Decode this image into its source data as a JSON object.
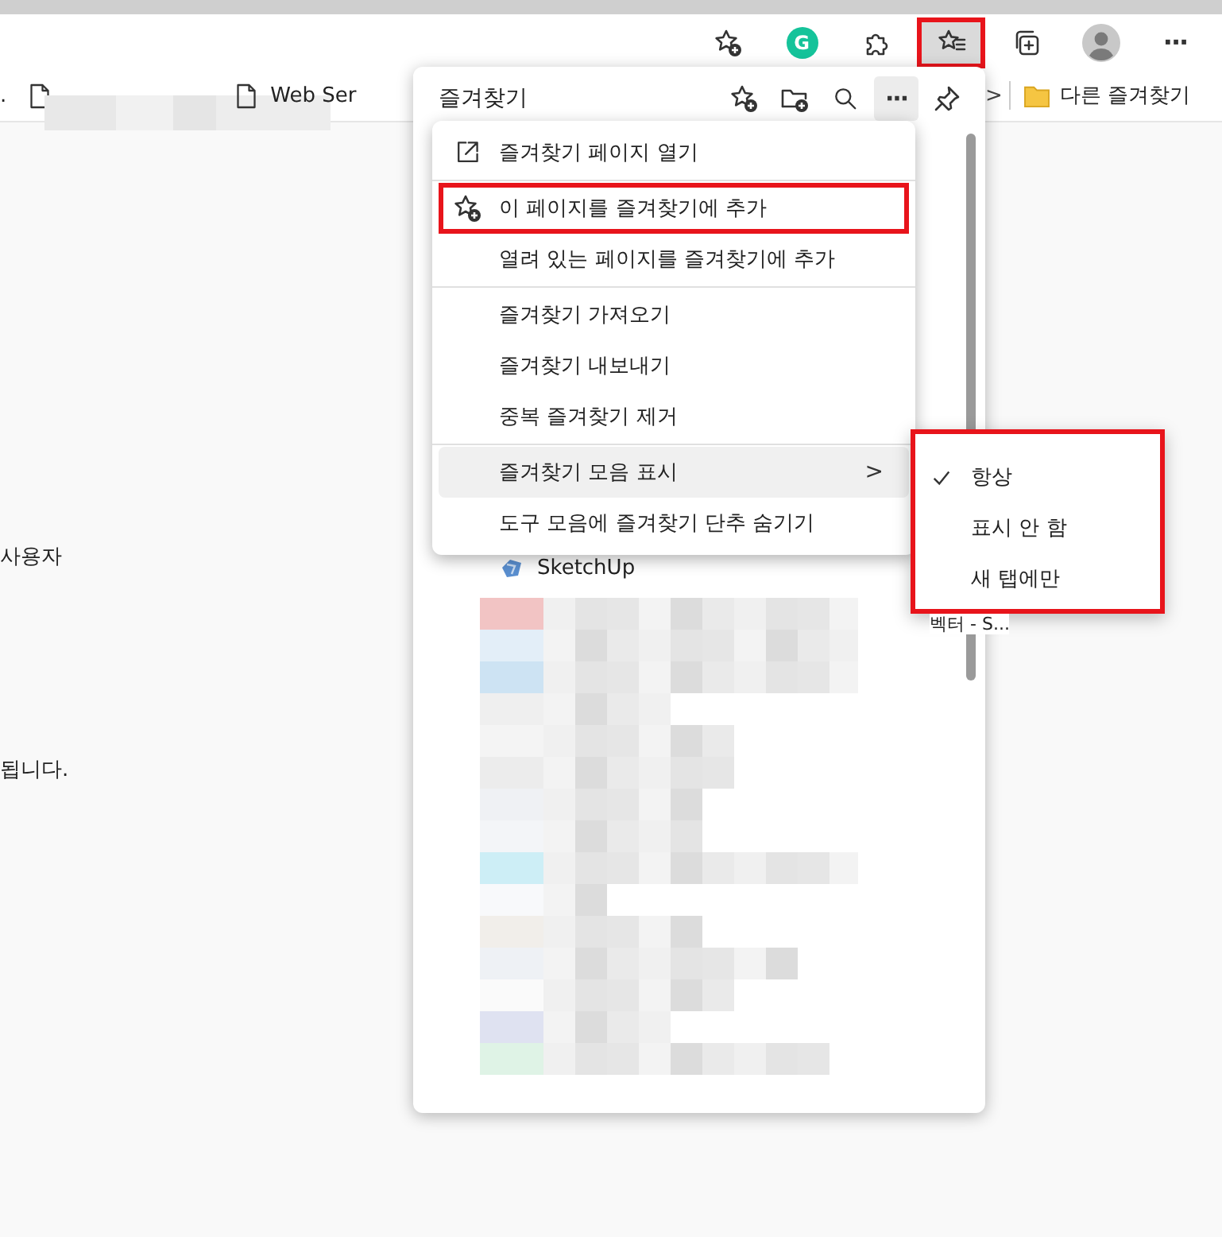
{
  "toolbar": {
    "buttons": [
      {
        "kind": "add_favorite",
        "highlighted": false
      },
      {
        "kind": "grammarly",
        "label": "G",
        "highlighted": false
      },
      {
        "kind": "extensions",
        "highlighted": false
      },
      {
        "kind": "favorites",
        "highlighted": true,
        "active": true
      },
      {
        "kind": "collections",
        "highlighted": false
      },
      {
        "kind": "profile",
        "highlighted": false
      },
      {
        "kind": "more",
        "label": "···",
        "highlighted": false
      }
    ]
  },
  "bookmarks_bar": {
    "items": [
      {
        "kind": "text",
        "label": "."
      },
      {
        "kind": "doc_redacted"
      },
      {
        "kind": "doc",
        "label": "Web Ser"
      }
    ],
    "overflow": ">",
    "other": "다른 즐겨찾기"
  },
  "page": {
    "texts": [
      "사용자",
      "됩니다."
    ]
  },
  "favorites_panel": {
    "title": "즐겨찾기",
    "header_buttons": [
      {
        "kind": "add_favorite"
      },
      {
        "kind": "add_folder"
      },
      {
        "kind": "search"
      },
      {
        "kind": "more",
        "label": "···",
        "active": true
      },
      {
        "kind": "pin"
      }
    ],
    "items": [
      {
        "title": "SketchUp",
        "redacted": false
      },
      {
        "title": "벡터 - S...",
        "redacted": true
      },
      {
        "redacted": true
      },
      {
        "redacted": true
      },
      {
        "redacted": true
      },
      {
        "redacted": true
      },
      {
        "redacted": true
      },
      {
        "redacted": true
      },
      {
        "redacted": true
      },
      {
        "redacted": true
      },
      {
        "redacted": true
      },
      {
        "redacted": true
      },
      {
        "redacted": true
      },
      {
        "redacted": true
      },
      {
        "redacted": true
      },
      {
        "redacted": true
      }
    ]
  },
  "context_menu": {
    "groups": [
      [
        {
          "label": "즐겨찾기 페이지 열기",
          "kind": "open",
          "highlighted": false,
          "hover": false
        }
      ],
      [
        {
          "label": "이 페이지를 즐겨찾기에 추가",
          "kind": "add_favorite",
          "highlighted": true,
          "hover": false
        },
        {
          "label": "열려 있는 페이지를 즐겨찾기에 추가",
          "highlighted": false,
          "hover": false
        }
      ],
      [
        {
          "label": "즐겨찾기 가져오기",
          "highlighted": false,
          "hover": false
        },
        {
          "label": "즐겨찾기 내보내기",
          "highlighted": false,
          "hover": false
        },
        {
          "label": "중복 즐겨찾기 제거",
          "highlighted": false,
          "hover": false
        }
      ],
      [
        {
          "label": "즐겨찾기 모음 표시",
          "submenu": true,
          "submenu_arrow": ">",
          "highlighted": false,
          "hover": true
        },
        {
          "label": "도구 모음에 즐겨찾기 단추 숨기기",
          "highlighted": false,
          "hover": false
        }
      ]
    ]
  },
  "submenu": {
    "highlighted": true,
    "items": [
      {
        "label": "항상",
        "selected": true
      },
      {
        "label": "표시 안 함",
        "selected": false
      },
      {
        "label": "새 탭에만",
        "selected": false
      }
    ]
  }
}
